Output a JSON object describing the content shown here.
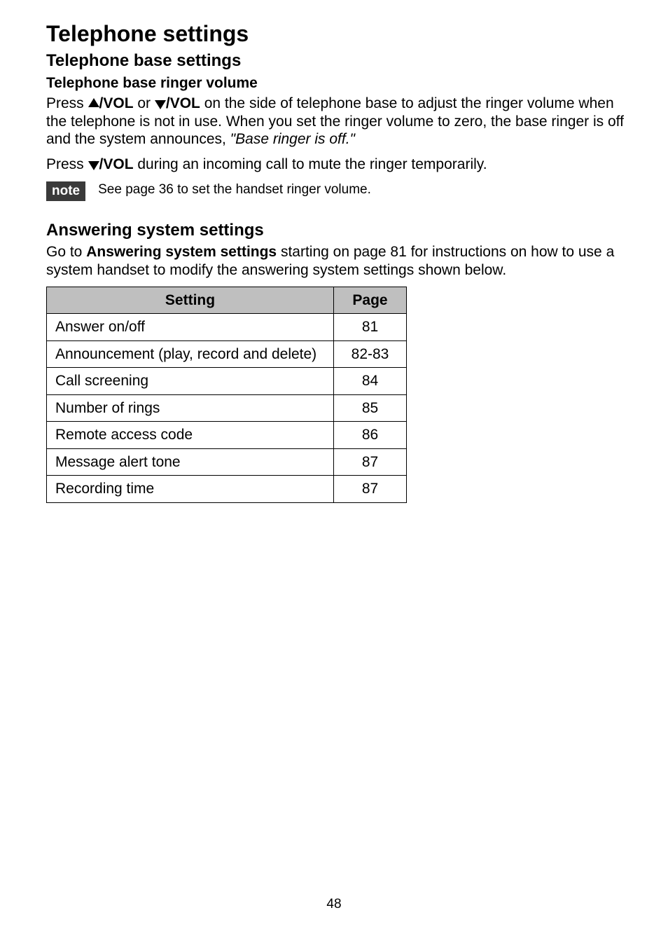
{
  "title": "Telephone settings",
  "section1": {
    "heading": "Telephone base settings",
    "subheading": "Telephone base ringer volume",
    "para1_a": "Press ",
    "para1_vol1": "/VOL",
    "para1_b": " or ",
    "para1_vol2": "/VOL",
    "para1_c": " on the side of telephone base to adjust the ringer volume when the telephone is not in use. When you set the ringer volume to zero, the base ringer is off and the system announces, ",
    "para1_italic": "\"Base ringer is off.\"",
    "para2_a": "Press ",
    "para2_vol": "/VOL",
    "para2_b": " during an incoming call to mute the ringer temporarily."
  },
  "note": {
    "label": "note",
    "text": "See page 36 to set the handset ringer volume."
  },
  "section2": {
    "heading": "Answering system settings",
    "para_a": "Go to ",
    "para_bold": "Answering system settings",
    "para_b": " starting on page 81 for instructions on how to use a system handset to modify the answering system settings shown below."
  },
  "table": {
    "header_setting": "Setting",
    "header_page": "Page",
    "rows": [
      {
        "setting": "Answer on/off",
        "page": "81"
      },
      {
        "setting": "Announcement (play, record and delete)",
        "page": "82-83"
      },
      {
        "setting": "Call screening",
        "page": "84"
      },
      {
        "setting": "Number of rings",
        "page": "85"
      },
      {
        "setting": "Remote access code",
        "page": "86"
      },
      {
        "setting": "Message alert tone",
        "page": "87"
      },
      {
        "setting": "Recording time",
        "page": "87"
      }
    ]
  },
  "page_number": "48"
}
